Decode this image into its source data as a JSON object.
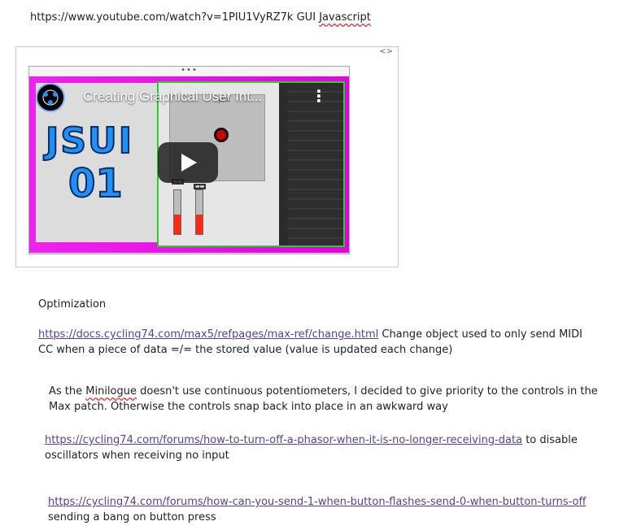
{
  "header": {
    "url": "https://www.youtube.com/watch?v=1PIU1VyRZ7k",
    "gui": "GUI",
    "javascript": "Javascript"
  },
  "embed": {
    "toggle_icon": "<>",
    "more_dots": "•••",
    "video_title": "Creating Graphical User Int...",
    "more_icon": "⋮",
    "thumbnail_text_1": "JSUI",
    "thumbnail_text_2": "01",
    "patcher_label": "JSUI",
    "icons": {
      "play": "play-button-icon",
      "channel": "channel-avatar-icon"
    }
  },
  "notes": {
    "heading": "Optimization",
    "link1": "https://docs.cycling74.com/max5/refpages/max-ref/change.html",
    "link1_rest": " Change object used to only send MIDI",
    "line1b": "CC when a piece of data =/= the stored value (value is updated each change)",
    "para2_a": "As the ",
    "para2_word": "Minilogue",
    "para2_b": " doesn't use continuous potentiometers, I decided to give priority to the controls in the",
    "para2_c": "Max patch. Otherwise the controls snap back into place in an awkward way",
    "link2": "https://cycling74.com/forums/how-to-turn-off-a-phasor-when-it-is-no-longer-receiving-data",
    "link2_rest": " to disable",
    "line3b": "oscillators when receiving no input",
    "link3": "https://cycling74.com/forums/how-can-you-send-1-when-button-flashes-send-0-when-button-turns-off",
    "line4b": "sending a bang on button press"
  }
}
